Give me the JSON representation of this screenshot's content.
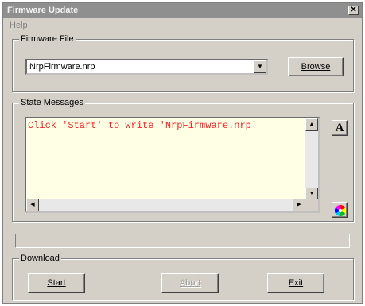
{
  "window": {
    "title": "Firmware Update",
    "close_glyph": "✕"
  },
  "menu": {
    "help": "Help"
  },
  "firmware_file": {
    "group_label": "Firmware File",
    "selected_file": "NrpFirmware.nrp",
    "browse_label": "Browse"
  },
  "state_messages": {
    "group_label": "State Messages",
    "message": "Click 'Start' to write 'NrpFirmware.nrp'",
    "font_button_label": "A"
  },
  "download": {
    "group_label": "Download",
    "start_label": "Start",
    "abort_label": "Abort",
    "exit_label": "Exit"
  },
  "icons": {
    "dropdown": "chevron-down-icon",
    "color_wheel": "color-wheel-icon",
    "close": "close-icon"
  },
  "colors": {
    "message_text": "#ff2020",
    "message_background": "#ffffe6",
    "title_bar": "#8f8f8f"
  }
}
